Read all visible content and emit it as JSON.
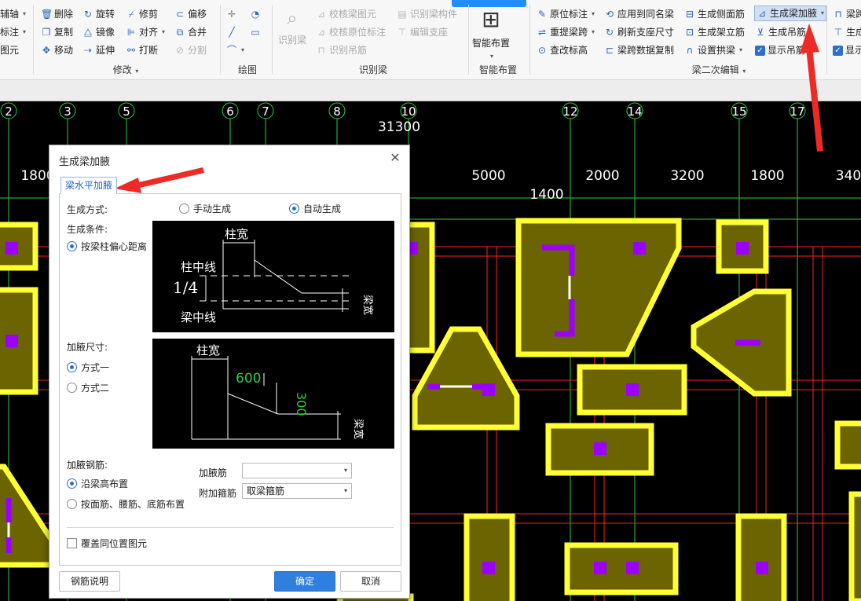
{
  "ribbon": {
    "left_cut": [
      "辅轴",
      "标注",
      "图元"
    ],
    "modify": {
      "items": [
        "删除",
        "旋转",
        "修剪",
        "偏移",
        "复制",
        "镜像",
        "对齐",
        "合并",
        "移动",
        "延伸",
        "打断",
        "分割"
      ],
      "label": "修改"
    },
    "draw": {
      "label": "绘图"
    },
    "identify": {
      "big_button": "识别梁",
      "items": [
        "校核梁图元",
        "识别梁构件",
        "校核原位标注",
        "编辑支座",
        "识别吊筋"
      ],
      "label": "识别梁"
    },
    "smart": {
      "big_button": "智能布置",
      "label": "智能布置"
    },
    "secondary": {
      "items": [
        "原位标注",
        "应用到同名梁",
        "生成侧面筋",
        "生成梁加腋",
        "重提梁跨",
        "刷新支座尺寸",
        "生成架立筋",
        "生成吊筋",
        "查改标高",
        "梁跨数据复制",
        "设置拱梁",
        "显示吊筋"
      ],
      "label": "梁二次编辑"
    },
    "right_cut": [
      "梁跨",
      "生成",
      "显示"
    ]
  },
  "canvas": {
    "axis_numbers": [
      "2",
      "3",
      "5",
      "6",
      "7",
      "8",
      "10",
      "12",
      "14",
      "15",
      "17"
    ],
    "total_dim": "31300",
    "dims": [
      "1800",
      "5000",
      "2000",
      "3200",
      "1800",
      "340",
      "1400"
    ],
    "colors": {
      "grid": "#2ecc40",
      "beam": "#ff2020",
      "column_border": "#ffff33",
      "column_fill": "#6b6400",
      "marker": "#9b00ff"
    }
  },
  "dialog": {
    "title": "生成梁加腋",
    "tab": "梁水平加腋",
    "gen_mode_label": "生成方式:",
    "gen_mode_manual": "手动生成",
    "gen_mode_auto": "自动生成",
    "condition_label": "生成条件:",
    "condition_option": "按梁柱偏心距离",
    "diag1": {
      "col_width": "柱宽",
      "col_center": "柱中线",
      "ratio": "1/4",
      "beam_center": "梁中线",
      "beam_width": "梁宽"
    },
    "size_label": "加腋尺寸:",
    "size_opt1": "方式一",
    "size_opt2": "方式二",
    "diag2": {
      "col_width": "柱宽",
      "len": "600",
      "depth": "300",
      "beam_width": "梁宽"
    },
    "rebar_label": "加腋钢筋:",
    "rebar_opt1": "沿梁高布置",
    "rebar_opt2": "按面筋、腰筋、底筋布置",
    "haunch_bar_label": "加腋筋",
    "haunch_bar_value": "",
    "stirrup_label": "附加箍筋",
    "stirrup_value": "取梁箍筋",
    "overwrite": "覆盖同位置图元",
    "btn_help": "钢筋说明",
    "btn_ok": "确定",
    "btn_cancel": "取消"
  }
}
